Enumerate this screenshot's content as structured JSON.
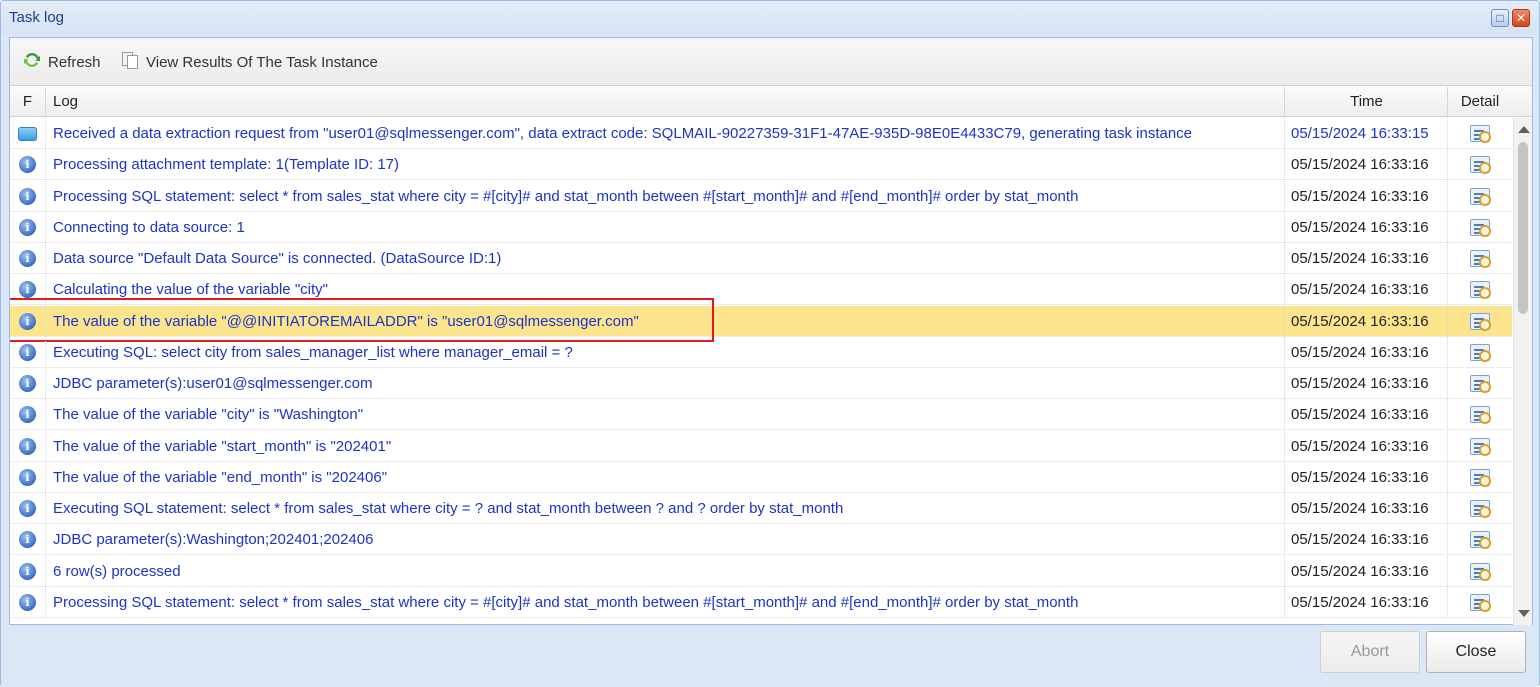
{
  "window": {
    "title": "Task log",
    "maximize_glyph": "□",
    "close_glyph": "✕"
  },
  "toolbar": {
    "refresh_label": "Refresh",
    "view_results_label": "View Results Of The Task Instance"
  },
  "columns": {
    "f": "F",
    "log": "Log",
    "time": "Time",
    "detail": "Detail"
  },
  "rows": [
    {
      "icon": "message-icon",
      "log": "Received a data extraction request from \"user01@sqlmessenger.com\", data extract code: SQLMAIL-90227359-31F1-47AE-935D-98E0E4433C79, generating task instance",
      "time": "05/15/2024 16:33:15"
    },
    {
      "icon": "info-icon",
      "log": "Processing attachment template: 1(Template ID: 17)",
      "time": "05/15/2024 16:33:16"
    },
    {
      "icon": "info-icon",
      "log": "Processing SQL statement: select * from sales_stat where city = #[city]# and stat_month between #[start_month]# and #[end_month]# order by stat_month",
      "time": "05/15/2024 16:33:16"
    },
    {
      "icon": "info-icon",
      "log": "Connecting to data source: 1",
      "time": "05/15/2024 16:33:16"
    },
    {
      "icon": "info-icon",
      "log": "Data source \"Default Data Source\" is connected. (DataSource ID:1)",
      "time": "05/15/2024 16:33:16"
    },
    {
      "icon": "info-icon",
      "log": "Calculating the value of the variable \"city\"",
      "time": "05/15/2024 16:33:16"
    },
    {
      "icon": "info-icon",
      "log": "The value of the variable \"@@INITIATOREMAILADDR\" is \"user01@sqlmessenger.com\"",
      "time": "05/15/2024 16:33:16",
      "highlight": true
    },
    {
      "icon": "info-icon",
      "log": "Executing SQL: select city from sales_manager_list where manager_email = ?",
      "time": "05/15/2024 16:33:16"
    },
    {
      "icon": "info-icon",
      "log": "JDBC parameter(s):user01@sqlmessenger.com",
      "time": "05/15/2024 16:33:16"
    },
    {
      "icon": "info-icon",
      "log": "The value of the variable \"city\" is \"Washington\"",
      "time": "05/15/2024 16:33:16"
    },
    {
      "icon": "info-icon",
      "log": "The value of the variable \"start_month\" is \"202401\"",
      "time": "05/15/2024 16:33:16"
    },
    {
      "icon": "info-icon",
      "log": "The value of the variable \"end_month\" is \"202406\"",
      "time": "05/15/2024 16:33:16"
    },
    {
      "icon": "info-icon",
      "log": "Executing SQL statement: select * from sales_stat where city = ? and stat_month between ? and ? order by stat_month",
      "time": "05/15/2024 16:33:16"
    },
    {
      "icon": "info-icon",
      "log": "JDBC parameter(s):Washington;202401;202406",
      "time": "05/15/2024 16:33:16"
    },
    {
      "icon": "info-icon",
      "log": "6 row(s) processed",
      "time": "05/15/2024 16:33:16"
    },
    {
      "icon": "info-icon",
      "log": "Processing SQL statement: select * from sales_stat where city = #[city]# and stat_month between #[start_month]# and #[end_month]# order by stat_month",
      "time": "05/15/2024 16:33:16"
    }
  ],
  "footer": {
    "abort_label": "Abort",
    "close_label": "Close"
  },
  "colors": {
    "log_text": "#1c33c8",
    "highlight_row": "#fde58d",
    "highlight_outline": "#e01b1b"
  }
}
